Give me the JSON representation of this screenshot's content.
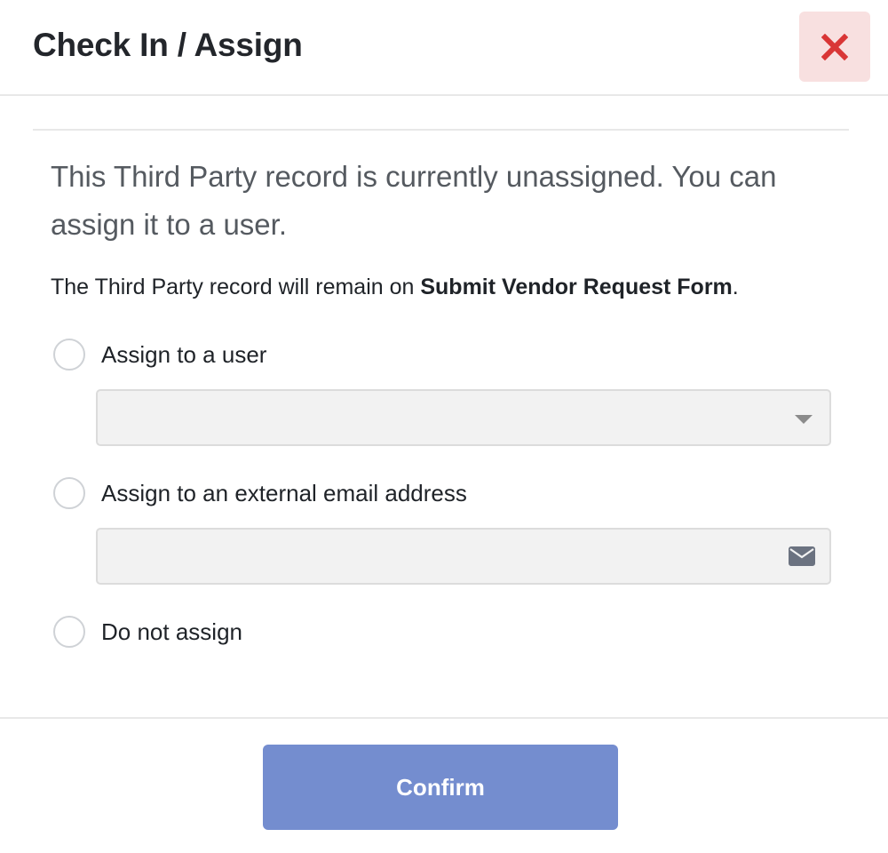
{
  "dialog": {
    "title": "Check In / Assign",
    "close_icon": "close-x-icon",
    "close_color": "#d93636"
  },
  "body": {
    "intro": "This Third Party record is currently unassigned. You can assign it to a user.",
    "note_prefix": "The Third Party record will remain on ",
    "note_stage": "Submit Vendor Request Form",
    "note_suffix": "."
  },
  "options": [
    {
      "label": "Assign to a user",
      "selected": false
    },
    {
      "label": "Assign to an external email address",
      "selected": false
    },
    {
      "label": "Do not assign",
      "selected": false
    }
  ],
  "fields": {
    "user_select": {
      "value": "",
      "icon": "chevron-down-icon"
    },
    "email_input": {
      "value": "",
      "placeholder": "",
      "icon": "envelope-icon"
    }
  },
  "footer": {
    "confirm_label": "Confirm",
    "confirm_color": "#748dcf"
  }
}
